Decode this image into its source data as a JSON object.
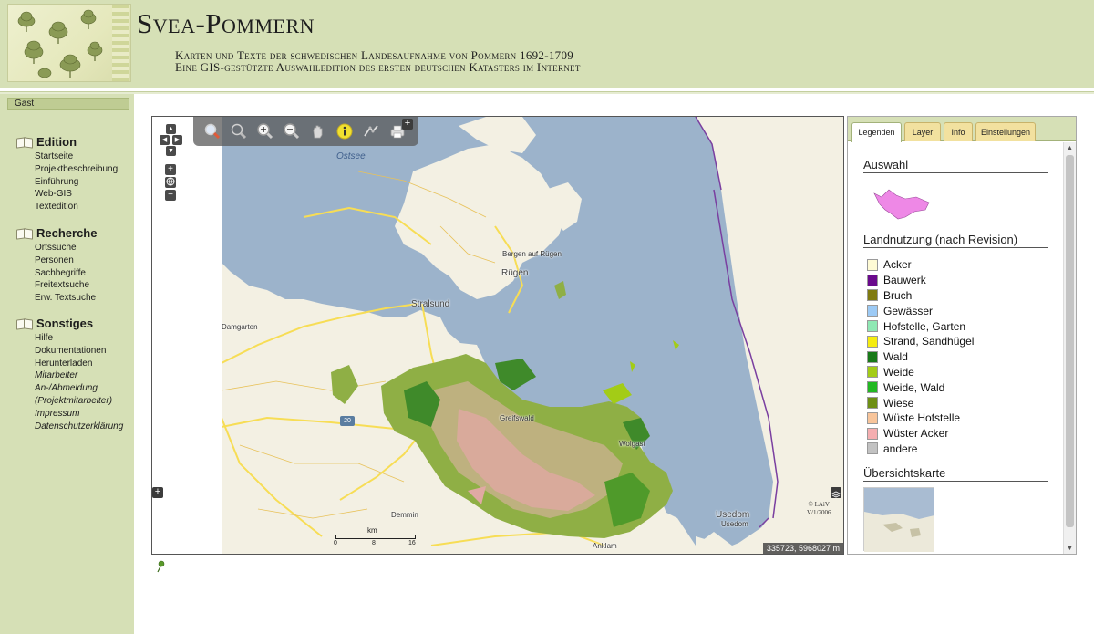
{
  "header": {
    "title": "Svea-Pommern",
    "subtitle_line1": "Karten und Texte der schwedischen Landesaufnahme von Pommern 1692-1709",
    "subtitle_line2": "Eine GIS-gestützte Auswahledition des ersten deutschen Katasters im Internet"
  },
  "user": {
    "label": "Gast"
  },
  "nav": {
    "edition": {
      "title": "Edition",
      "items": [
        "Startseite",
        "Projektbeschreibung",
        "Einführung",
        "Web-GIS",
        "Textedition"
      ]
    },
    "recherche": {
      "title": "Recherche",
      "items": [
        "Ortssuche",
        "Personen",
        "Sachbegriffe",
        "Freitextsuche",
        "Erw. Textsuche"
      ]
    },
    "sonstiges": {
      "title": "Sonstiges",
      "items": [
        "Hilfe",
        "Dokumentationen",
        "Herunterladen",
        "Mitarbeiter",
        "An-/Abmeldung",
        "(Projektmitarbeiter)",
        "Impressum",
        "Datenschutzerklärung"
      ]
    }
  },
  "map": {
    "toolbar_expand": "+",
    "sidebar_expand": "+",
    "zoom_in": "+",
    "zoom_out": "−",
    "places": {
      "ostsee": "Ostsee",
      "bergen": "Bergen auf Rügen",
      "ruegen": "Rügen",
      "stralsund": "Stralsund",
      "damgarten": "Damgarten",
      "greifswald": "Greifswald",
      "wolgast": "Wolgast",
      "demmin": "Demmin",
      "usedom": "Usedom",
      "usedom2": "Usedom",
      "anklam": "Anklam"
    },
    "route_number": "20",
    "scale": {
      "unit": "km",
      "ticks": [
        "0",
        "8",
        "16"
      ]
    },
    "copyright_line1": "© LAiV",
    "copyright_line2": "V/1/2006",
    "coordinates": "335723, 5968027 m"
  },
  "panel": {
    "tabs": [
      "Legenden",
      "Layer",
      "Info",
      "Einstellungen"
    ],
    "active_tab": "Legenden",
    "selection_heading": "Auswahl",
    "landuse_heading": "Landnutzung (nach Revision)",
    "legend": [
      {
        "label": "Acker",
        "color": "#fffbd5"
      },
      {
        "label": "Bauwerk",
        "color": "#6a0a8c"
      },
      {
        "label": "Bruch",
        "color": "#7f7a10"
      },
      {
        "label": "Gewässer",
        "color": "#9ccaf5"
      },
      {
        "label": "Hofstelle, Garten",
        "color": "#8fe8b4"
      },
      {
        "label": "Strand, Sandhügel",
        "color": "#f5ec10"
      },
      {
        "label": "Wald",
        "color": "#187a18"
      },
      {
        "label": "Weide",
        "color": "#a3cc16"
      },
      {
        "label": "Weide, Wald",
        "color": "#22b822"
      },
      {
        "label": "Wiese",
        "color": "#6e8f14"
      },
      {
        "label": "Wüste Hofstelle",
        "color": "#f8c59b"
      },
      {
        "label": "Wüster Acker",
        "color": "#f5aeb0"
      },
      {
        "label": "andere",
        "color": "#c2c2c2"
      }
    ],
    "overview_heading": "Übersichtskarte"
  },
  "colors": {
    "header_bg": "#d6e0b6",
    "sea": "#9cb3cb",
    "selection": "#ee88e6"
  }
}
